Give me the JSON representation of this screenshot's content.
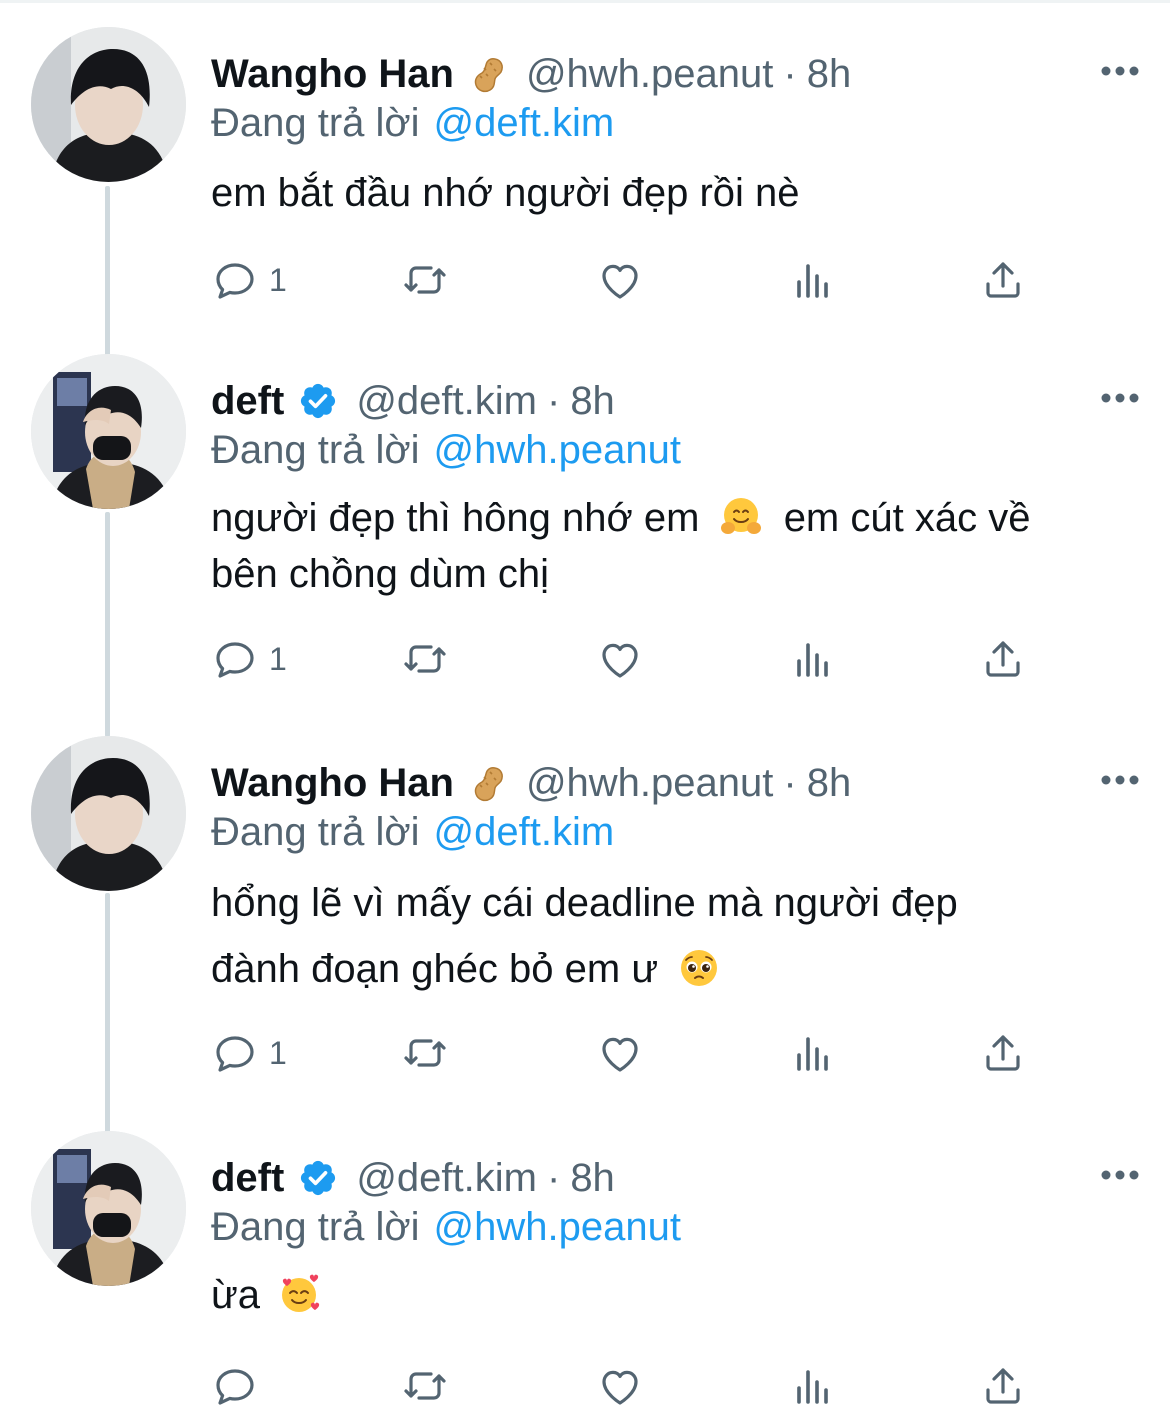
{
  "tweets": [
    {
      "name": "Wangho Han",
      "handle": "@hwh.peanut",
      "sep": "·",
      "time": "8h",
      "replying_label": "Đang trả lời",
      "mention": "@deft.kim",
      "text_lines": [
        "em bắt đầu nhớ người đẹp rồi nè"
      ],
      "reply_count": "1",
      "badge": "peanut-emoji"
    },
    {
      "name": "deft",
      "handle": "@deft.kim",
      "sep": "·",
      "time": "8h",
      "replying_label": "Đang trả lời",
      "mention": "@hwh.peanut",
      "text_lines": [
        "người đẹp thì hông nhớ em",
        "em cút xác về",
        "bên chồng dùm chị"
      ],
      "reply_count": "1",
      "badge": "verified-badge"
    },
    {
      "name": "Wangho Han",
      "handle": "@hwh.peanut",
      "sep": "·",
      "time": "8h",
      "replying_label": "Đang trả lời",
      "mention": "@deft.kim",
      "text_lines": [
        "hổng lẽ vì mấy cái deadline mà người đẹp",
        "đành đoạn ghéc bỏ em ư"
      ],
      "reply_count": "1",
      "badge": "peanut-emoji"
    },
    {
      "name": "deft",
      "handle": "@deft.kim",
      "sep": "·",
      "time": "8h",
      "replying_label": "Đang trả lời",
      "mention": "@hwh.peanut",
      "text_lines": [
        "ừa"
      ],
      "reply_count": "",
      "badge": "verified-badge"
    }
  ],
  "colors": {
    "text": "#0f1419",
    "secondary": "#536471",
    "link": "#1d9bf0",
    "thread_line": "#cfd9de",
    "verified": "#1d9bf0"
  },
  "icons": [
    "reply-icon",
    "retweet-icon",
    "like-icon",
    "views-icon",
    "share-icon",
    "more-icon"
  ]
}
